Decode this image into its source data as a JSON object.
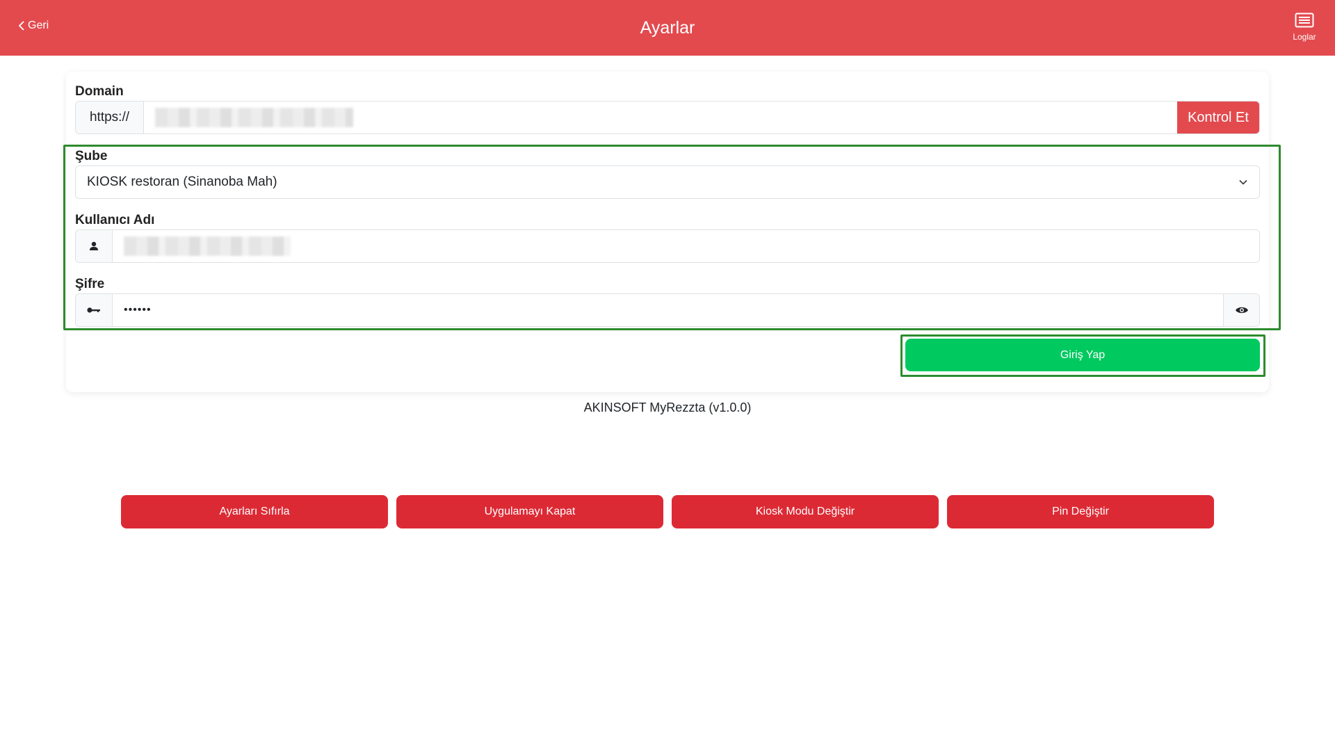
{
  "header": {
    "back_label": "Geri",
    "title": "Ayarlar",
    "logs_label": "Loglar",
    "bg_color": "#e34a4e"
  },
  "form": {
    "domain": {
      "label": "Domain",
      "prefix": "https://",
      "check_button": "Kontrol Et"
    },
    "branch": {
      "label": "Şube",
      "selected": "KIOSK restoran (Sinanoba Mah)"
    },
    "username": {
      "label": "Kullanıcı Adı",
      "icon": "user-icon"
    },
    "password": {
      "label": "Şifre",
      "value": "••••••",
      "icon": "key-icon",
      "toggle_icon": "eye-icon"
    },
    "login_button": "Giriş Yap",
    "login_color": "#00c95f"
  },
  "version": "AKINSOFT MyRezzta (v1.0.0)",
  "actions": [
    {
      "label": "Ayarları Sıfırla"
    },
    {
      "label": "Uygulamayı Kapat"
    },
    {
      "label": "Kiosk Modu Değiştir"
    },
    {
      "label": "Pin Değiştir"
    }
  ],
  "colors": {
    "accent": "#e34a4e",
    "danger": "#dc2a35",
    "success": "#00c95f",
    "highlight": "#2e8b2e"
  }
}
